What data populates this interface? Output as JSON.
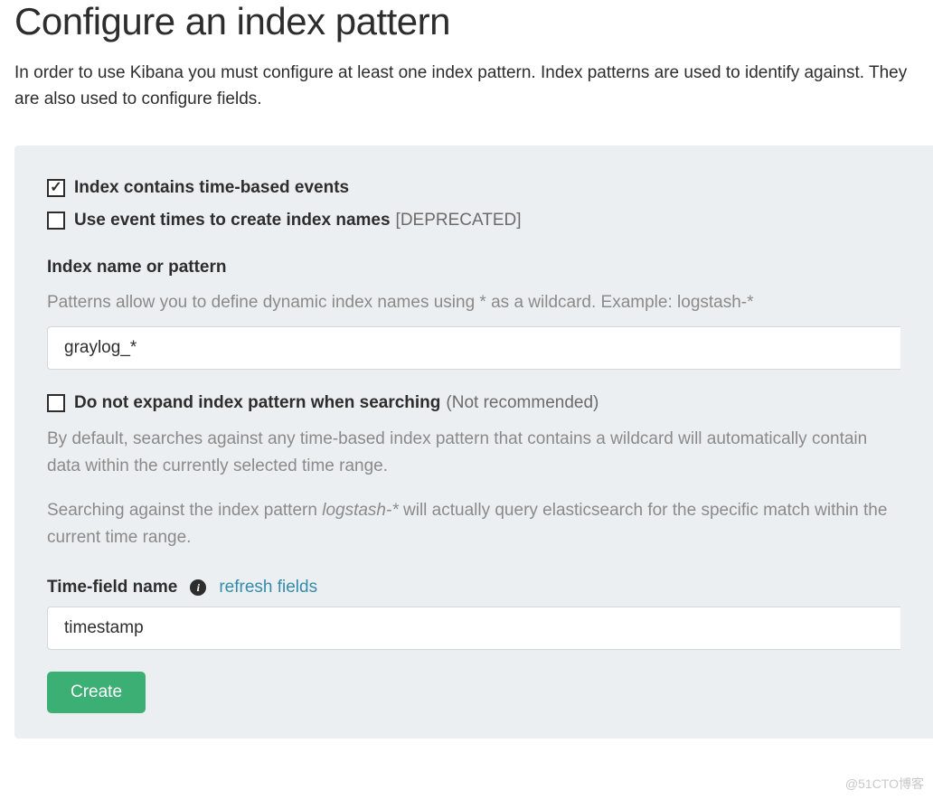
{
  "header": {
    "title": "Configure an index pattern",
    "intro": "In order to use Kibana you must configure at least one index pattern. Index patterns are used to identify against. They are also used to configure fields."
  },
  "checkboxes": {
    "time_based": {
      "label": "Index contains time-based events",
      "checked": true
    },
    "event_times": {
      "label": "Use event times to create index names",
      "suffix": "[DEPRECATED]",
      "checked": false
    },
    "no_expand": {
      "label": "Do not expand index pattern when searching",
      "suffix": "(Not recommended)",
      "checked": false
    }
  },
  "index_field": {
    "label": "Index name or pattern",
    "hint": "Patterns allow you to define dynamic index names using * as a wildcard. Example: logstash-*",
    "value": "graylog_*"
  },
  "expand_desc": {
    "line1": "By default, searches against any time-based index pattern that contains a wildcard will automatically contain data within the currently selected time range.",
    "line2_pre": "Searching against the index pattern ",
    "line2_em": "logstash-*",
    "line2_post": " will actually query elasticsearch for the specific match within the current time range."
  },
  "time_field": {
    "label": "Time-field name",
    "refresh": "refresh fields",
    "value": "timestamp"
  },
  "buttons": {
    "create": "Create"
  },
  "watermark": "@51CTO博客"
}
